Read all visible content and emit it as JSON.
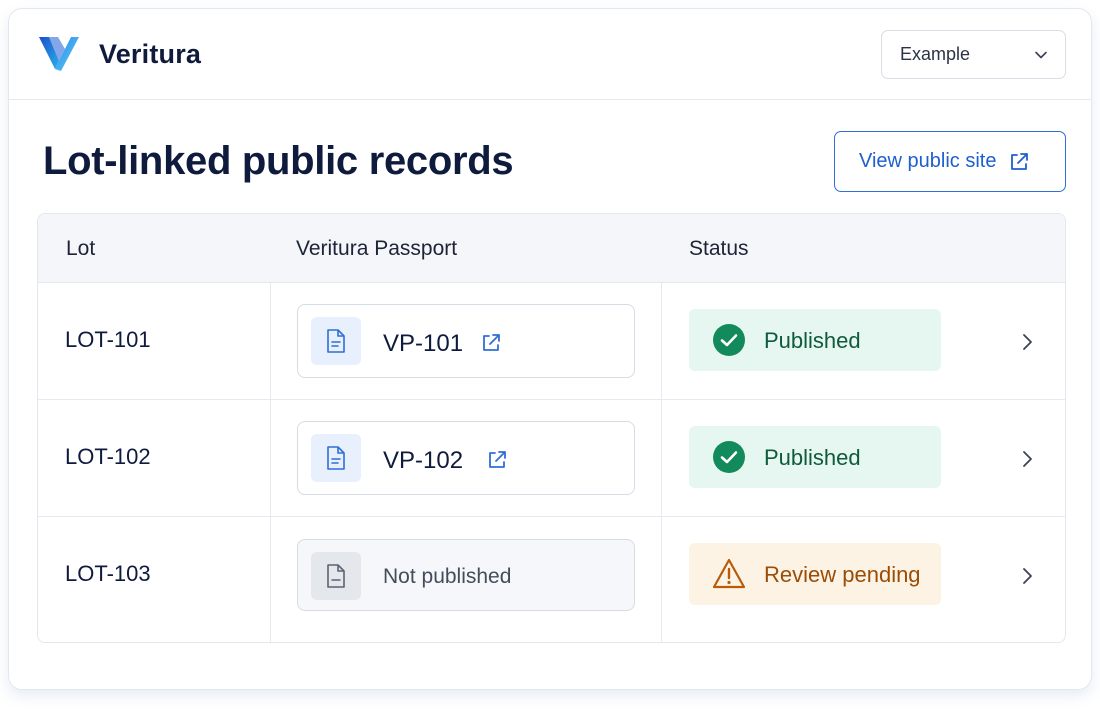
{
  "header": {
    "brand": "Veritura",
    "workspace_select": {
      "value": "Example"
    }
  },
  "page": {
    "title": "Lot-linked public records",
    "view_public_site_label": "View public site"
  },
  "table": {
    "columns": [
      "Lot",
      "Veritura Passport",
      "Status"
    ],
    "rows": [
      {
        "lot": "LOT-101",
        "passport": "VP-101",
        "passport_linked": true,
        "status": "Published",
        "status_kind": "success"
      },
      {
        "lot": "LOT-102",
        "passport": "VP-102",
        "passport_linked": true,
        "status": "Published",
        "status_kind": "success"
      },
      {
        "lot": "LOT-103",
        "passport": "Not published",
        "passport_linked": false,
        "status": "Review pending",
        "status_kind": "warning"
      }
    ]
  },
  "icons": {
    "logo": "veritura-logo-icon",
    "select": "chevron-down-icon",
    "external": "external-link-icon",
    "document": "document-icon",
    "success": "check-circle-icon",
    "warning": "warning-triangle-icon",
    "row_action": "chevron-right-icon"
  },
  "colors": {
    "accent": "#1e5fcf",
    "text": "#0f1b3d",
    "success_bg": "#e6f7f1",
    "success_icon": "#138a5b",
    "warning_bg": "#fdf3e4",
    "warning_icon": "#b85c0c"
  }
}
